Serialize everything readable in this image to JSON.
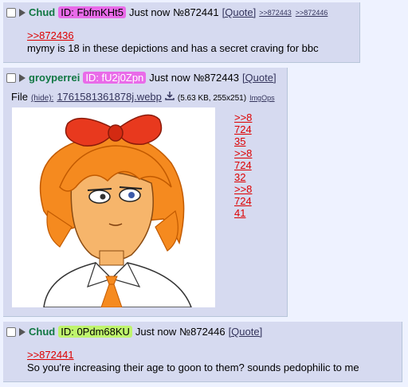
{
  "posts": [
    {
      "name": "Chud",
      "id_label": "ID: FbfmKHt5",
      "id_color": "#e96be9",
      "time": "Just now",
      "number": "№872441",
      "quote_label": "[Quote]",
      "backlinks": [
        ">>872443",
        ">>872446"
      ],
      "quote_link": ">>872436",
      "text": "mymy is 18 in these depictions and has a secret craving for bbc"
    },
    {
      "name": "groyperrei",
      "id_label": "ID: fU2j0Zpn",
      "id_color": "#e96be9",
      "time": "Just now",
      "number": "№872443",
      "quote_label": "[Quote]",
      "file": {
        "label": "File",
        "hide": "(hide):",
        "filename": "1761581361878j.webp",
        "download_icon": "download-icon",
        "size": "(5.63 KB, 255x251)",
        "imgops": "ImgOps"
      },
      "quote_lines": [
        ">>8",
        "724",
        "35",
        ">>8",
        "724",
        "32",
        ">>8",
        "724",
        "41"
      ]
    },
    {
      "name": "Chud",
      "id_label": "ID: 0Pdm68KU",
      "id_color": "#bff46d",
      "time": "Just now",
      "number": "№872446",
      "quote_label": "[Quote]",
      "quote_link": ">>872441",
      "text": "So you're increasing their age to goon to them? sounds pedophilic to me"
    }
  ]
}
